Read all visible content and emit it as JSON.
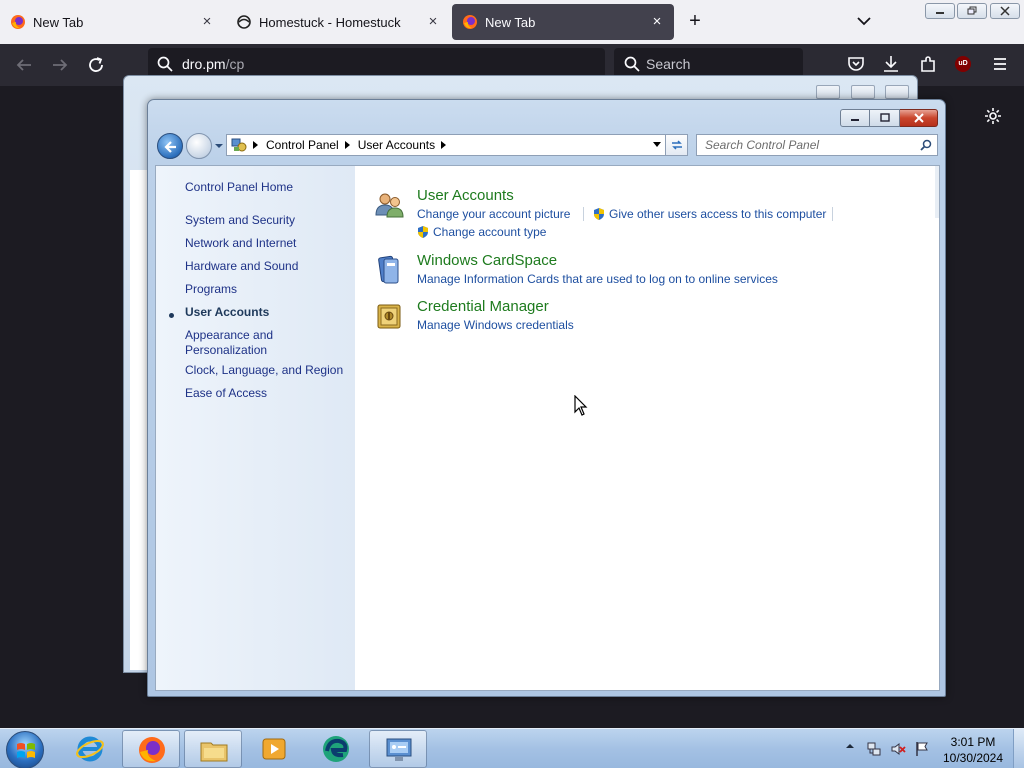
{
  "browser": {
    "tabs": [
      {
        "title": "New Tab",
        "icon": "firefox-icon",
        "active": false
      },
      {
        "title": "Homestuck - Homestuck",
        "icon": "homestuck-icon",
        "active": false
      },
      {
        "title": "New Tab",
        "icon": "firefox-icon",
        "active": true
      }
    ],
    "new_tab_symbol": "+",
    "close_symbol": "×",
    "url_host": "dro.pm",
    "url_path": "/cp",
    "search_placeholder": "Search",
    "ublock_label": "uD"
  },
  "control_panel": {
    "breadcrumbs": [
      "Control Panel",
      "User Accounts"
    ],
    "search_placeholder": "Search Control Panel",
    "left_pane": {
      "home": "Control Panel Home",
      "items": [
        {
          "label": "System and Security",
          "current": false
        },
        {
          "label": "Network and Internet",
          "current": false
        },
        {
          "label": "Hardware and Sound",
          "current": false
        },
        {
          "label": "Programs",
          "current": false
        },
        {
          "label": "User Accounts",
          "current": true
        },
        {
          "label": "Appearance and Personalization",
          "current": false
        },
        {
          "label": "Clock, Language, and Region",
          "current": false
        },
        {
          "label": "Ease of Access",
          "current": false
        }
      ]
    },
    "categories": [
      {
        "title": "User Accounts",
        "icon": "user-accounts-icon",
        "links": [
          "Change your account picture",
          "Give other users access to this computer",
          "Change account type"
        ]
      },
      {
        "title": "Windows CardSpace",
        "icon": "cardspace-icon",
        "links": [
          "Manage Information Cards that are used to log on to online services"
        ]
      },
      {
        "title": "Credential Manager",
        "icon": "credential-manager-icon",
        "links": [
          "Manage Windows credentials"
        ]
      }
    ]
  },
  "taskbar": {
    "time": "3:01 PM",
    "date": "10/30/2024",
    "apps": [
      "internet-explorer-icon",
      "firefox-icon",
      "file-explorer-icon",
      "media-player-icon",
      "edge-icon",
      "control-panel-icon"
    ]
  },
  "colors": {
    "browser_tabstrip": "#f0f0f4",
    "browser_toolbar": "#2b2a33",
    "active_tab": "#42414d",
    "category_title": "#1e7b1e",
    "link": "#1e4fa0",
    "taskbar": "#a4c1e4"
  }
}
